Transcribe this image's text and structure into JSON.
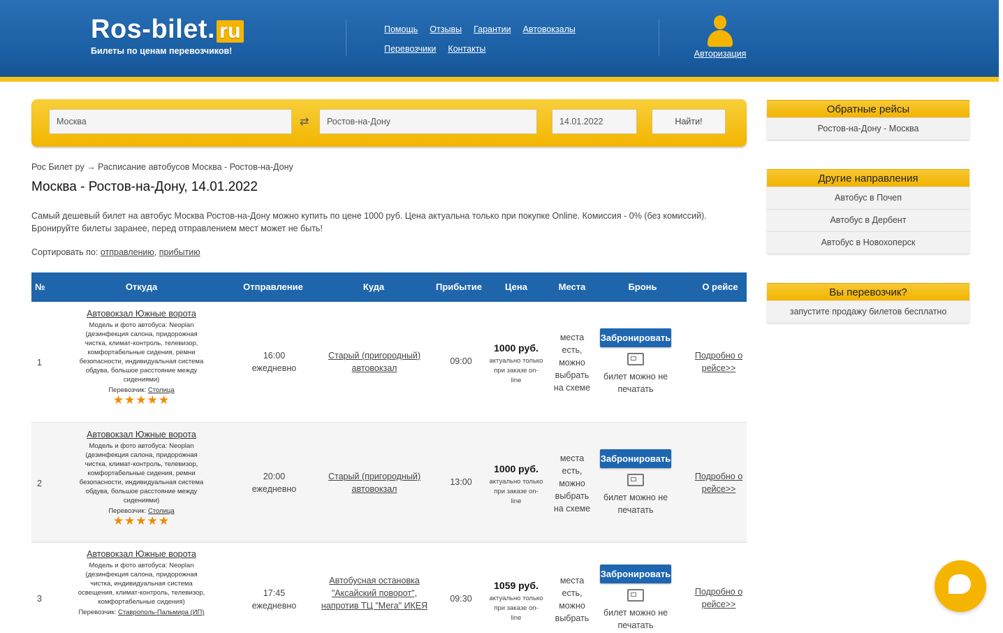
{
  "header": {
    "logo_main": "Ros-bilet.",
    "logo_tld": "ru",
    "logo_tagline": "Билеты по ценам перевозчиков!",
    "nav": [
      "Помощь",
      "Отзывы",
      "Гарантии",
      "Автовокзалы",
      "Перевозчики",
      "Контакты"
    ],
    "auth_label": "Авторизация"
  },
  "search": {
    "from": "Москва",
    "to": "Ростов-на-Дону",
    "date": "14.01.2022",
    "button": "Найти!"
  },
  "breadcrumb": "Рос Билет ру → Расписание автобусов Москва - Ростов-на-Дону",
  "page_title": "Москва - Ростов-на-Дону, 14.01.2022",
  "description": "Самый дешевый билет на автобус Москва Ростов-на-Дону можно купить по цене 1000 руб. Цена актуальна только при покупке Online. Комиссия - 0% (без комиссий). Бронируйте билеты заранее, перед отправлением мест может не быть!",
  "sort": {
    "label": "Сортировать по:",
    "by_departure": "отправлению",
    "by_arrival": "прибытию"
  },
  "table": {
    "headers": [
      "№",
      "Откуда",
      "Отправление",
      "Куда",
      "Прибытие",
      "Цена",
      "Места",
      "Бронь",
      "О рейсе"
    ],
    "rows": [
      {
        "num": "1",
        "station": "Автовокзал Южные ворота",
        "bus_desc": "Модель и фото автобуса: Neoplan (дезинфекция салона, придорожная чистка, климат-контроль, телевизор, комфортабельные сидения, ремни безопасности, индивидуальная система обдува, большое расстояние между сидениями)",
        "carrier_label": "Перевозчик:",
        "carrier": "Столица",
        "stars": "★★★★★",
        "dep_time": "16:00",
        "dep_freq": "ежедневно",
        "to": "Старый (пригородный) автовокзал",
        "arr_time": "09:00",
        "price": "1000 руб.",
        "price_note": "актуально только при заказе on-line",
        "seats": "места есть, можно выбрать на схеме",
        "book_btn": "Забронировать",
        "book_note": "билет можно не печатать",
        "info": "Подробно о рейсе>>"
      },
      {
        "num": "2",
        "station": "Автовокзал Южные ворота",
        "bus_desc": "Модель и фото автобуса: Neoplan (дезинфекция салона, придорожная чистка, климат-контроль, телевизор, комфортабельные сидения, ремни безопасности, индивидуальная система обдува, большое расстояние между сидениями)",
        "carrier_label": "Перевозчик:",
        "carrier": "Столица",
        "stars": "★★★★★",
        "dep_time": "20:00",
        "dep_freq": "ежедневно",
        "to": "Старый (пригородный) автовокзал",
        "arr_time": "13:00",
        "price": "1000 руб.",
        "price_note": "актуально только при заказе on-line",
        "seats": "места есть, можно выбрать на схеме",
        "book_btn": "Забронировать",
        "book_note": "билет можно не печатать",
        "info": "Подробно о рейсе>>"
      },
      {
        "num": "3",
        "station": "Автовокзал Южные ворота",
        "bus_desc": "Модель и фото автобуса: Neoplan (дезинфекция салона, придорожная чистка, индивидуальная система освещения, климат-контроль, телевизор, комфортабельные сидения)",
        "carrier_label": "Перевозчик:",
        "carrier": "Ставрополь-Пальмира (ИП)",
        "stars": "",
        "dep_time": "17:45",
        "dep_freq": "ежедневно",
        "to": "Автобусная остановка \"Аксайский поворот\", напротив ТЦ \"Мега\" ИКЕЯ",
        "arr_time": "09:30",
        "price": "1059 руб.",
        "price_note": "актуально только при заказе on-line",
        "seats": "места есть, можно выбрать",
        "book_btn": "Забронировать",
        "book_note": "билет можно не печатать",
        "info": "Подробно о рейсе>>"
      }
    ]
  },
  "sidebar": {
    "return_title": "Обратные рейсы",
    "return_item": "Ростов-на-Дону - Москва",
    "other_title": "Другие направления",
    "other_items": [
      "Автобус в Почеп",
      "Автобус в Дербент",
      "Автобус в Новохоперск"
    ],
    "carrier_title": "Вы перевозчик?",
    "carrier_item": "запустите продажу билетов бесплатно"
  },
  "colors": {
    "header_blue": "#1a5ea3",
    "accent_yellow": "#f5b400",
    "table_header": "#1f65ab",
    "book_button": "#1e66b0"
  },
  "icons": [
    "user-icon",
    "swap-icon",
    "star-icon",
    "print-icon",
    "chat-icon"
  ]
}
